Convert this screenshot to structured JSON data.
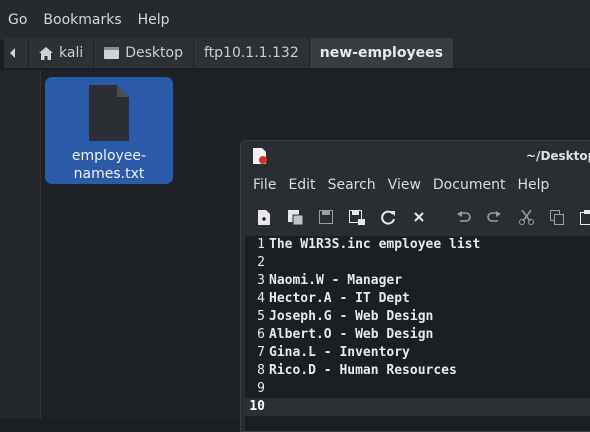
{
  "file_manager": {
    "menu": [
      "Go",
      "Bookmarks",
      "Help"
    ],
    "path": [
      "kali",
      "Desktop",
      "ftp10.1.1.132",
      "new-employees"
    ],
    "file": {
      "name_line1": "employee-",
      "name_line2": "names.txt"
    }
  },
  "editor": {
    "title": "~/Desktop/f",
    "menu": [
      "File",
      "Edit",
      "Search",
      "View",
      "Document",
      "Help"
    ],
    "toolbar": [
      "new-file-icon",
      "new-window-icon",
      "save-icon",
      "save-as-icon",
      "reload-icon",
      "close-icon",
      "undo-icon",
      "redo-icon",
      "cut-icon",
      "copy-icon",
      "paste-icon"
    ],
    "lines": [
      {
        "n": "1",
        "text": "The W1R3S.inc employee list"
      },
      {
        "n": "2",
        "text": ""
      },
      {
        "n": "3",
        "text": "Naomi.W - Manager"
      },
      {
        "n": "4",
        "text": "Hector.A - IT Dept"
      },
      {
        "n": "5",
        "text": "Joseph.G - Web Design"
      },
      {
        "n": "6",
        "text": "Albert.O - Web Design"
      },
      {
        "n": "7",
        "text": "Gina.L - Inventory"
      },
      {
        "n": "8",
        "text": "Rico.D - Human Resources"
      },
      {
        "n": "9",
        "text": ""
      },
      {
        "n": "10",
        "text": ""
      }
    ]
  }
}
